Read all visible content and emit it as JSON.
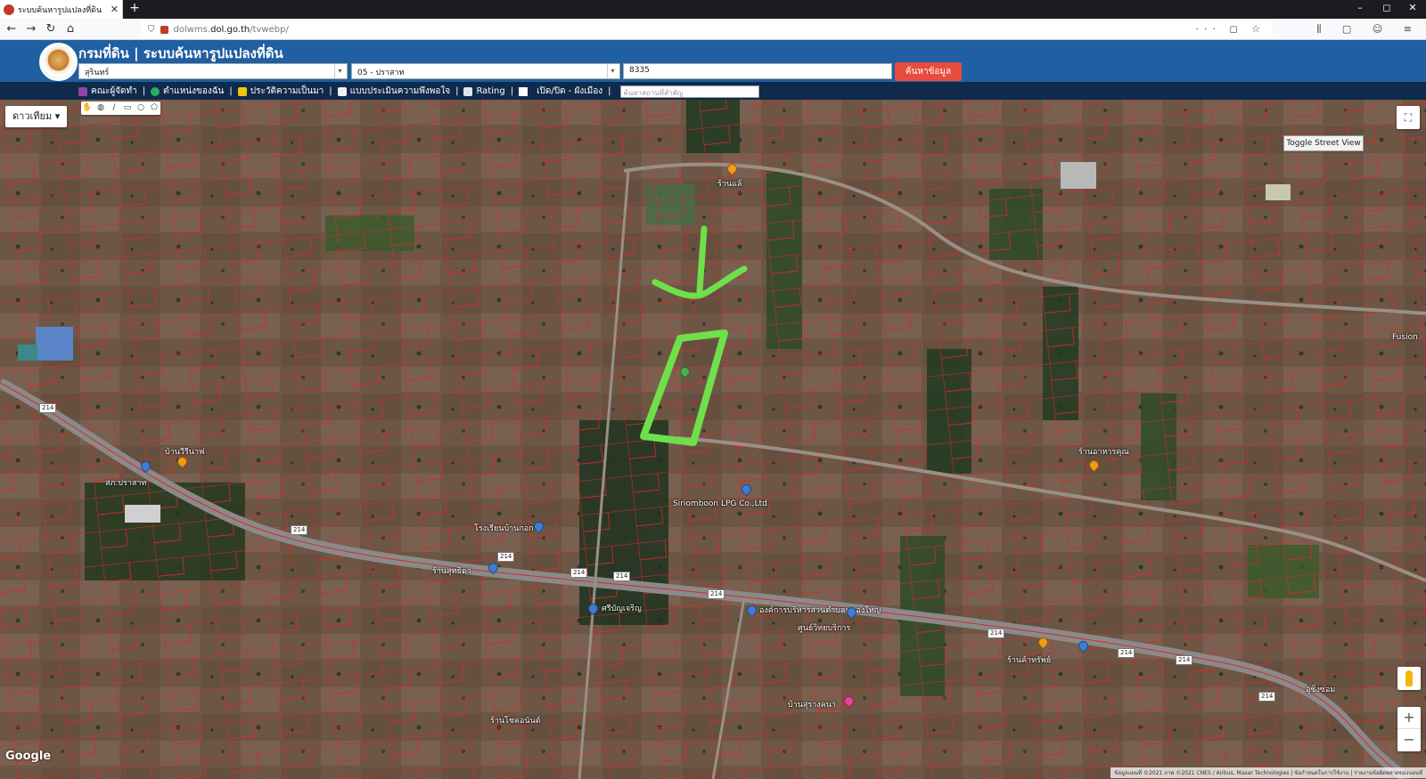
{
  "browser": {
    "tab_title": "ระบบค้นหารูปแปลงที่ดิน",
    "new_tab": "+",
    "url_prefix": "dolwms.",
    "url_host": "dol.go.th",
    "url_path": "/tvwebp/",
    "url_tools": "··· ◻ ☆",
    "nav_tools": "⫼ ▢ ☺ ≡",
    "window_controls": [
      "–",
      "◻",
      "✕"
    ]
  },
  "header": {
    "title": "กรมที่ดิน | ระบบค้นหารูปแปลงที่ดิน",
    "province": "สุรินทร์",
    "district": "05 - ปราสาท",
    "parcel_number": "8335",
    "search_button": "ค้นหาข้อมูล"
  },
  "menu": {
    "items": [
      {
        "label": "คณะผู้จัดทำ",
        "icon": "people-icon"
      },
      {
        "label": "ตำแหน่งของฉัน",
        "icon": "globe-icon"
      },
      {
        "label": "ประวัติความเป็นมา",
        "icon": "sprout-icon"
      },
      {
        "label": "แบบประเมินความพึงพอใจ",
        "icon": "form-icon"
      },
      {
        "label": "Rating",
        "icon": "rating-icon"
      },
      {
        "label": "เปิด/ปิด - ผังเมือง",
        "icon": "checkbox-icon"
      }
    ],
    "place_search_placeholder": "ค้นหาสถานที่สำคัญ"
  },
  "map": {
    "map_type": "ดาวเทียม",
    "toggle_street_view": "Toggle Street View",
    "google": "Google",
    "attribution": "ข้อมูลแผนที่ ©2021 ภาพ ©2021 CNES / Airbus, Maxar Technologies | ข้อกำหนดในการใช้งาน | รายงานข้อผิดพลาดของแผนที่",
    "road_number": "214",
    "pois": [
      "ร้านแล้",
      "บ้านวีรีนาฟ",
      "สภ.ปราสาท",
      "Siriomboon LPG Co.,Ltd",
      "โรงเรียนบ้านกอก",
      "ร้านสุทธิดา",
      "ศรีบัญเจริญ",
      "องค์การบริหารส่วนตำบลหนองใหญ่",
      "ศูนย์วิทยบริการ",
      "บ้านสุรางคนา",
      "ร้านโชคอนันต์",
      "ร้านค้าทรัพย์",
      "ร้านอาหารคุณ",
      "อู่ซิ่งซ่อม",
      "Fusion"
    ]
  }
}
